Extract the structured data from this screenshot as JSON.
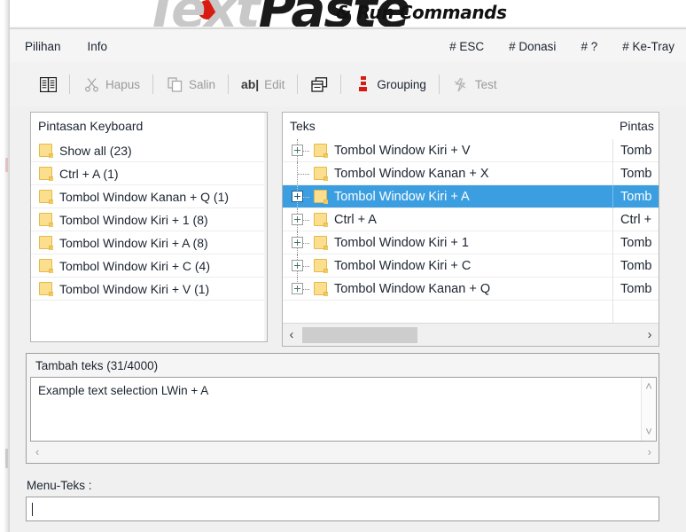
{
  "app": {
    "logo_part1": "Text",
    "logo_part2": "Paste",
    "logo_subtitle": "& Run Commands"
  },
  "menubar": {
    "left_items": [
      {
        "label": "Pilihan",
        "name": "menu-pilihan"
      },
      {
        "label": "Info",
        "name": "menu-info"
      }
    ],
    "right_items": [
      {
        "label": "# ESC",
        "name": "menu-esc"
      },
      {
        "label": "# Donasi",
        "name": "menu-donasi"
      },
      {
        "label": "# ?",
        "name": "menu-help"
      },
      {
        "label": "# Ke-Tray",
        "name": "menu-ke-tray"
      }
    ]
  },
  "toolbar": {
    "items": [
      {
        "label": "",
        "icon": "list-book-icon",
        "enabled": true,
        "name": "toolbar-list-button"
      },
      {
        "label": "Hapus",
        "icon": "scissors-icon",
        "enabled": false,
        "name": "toolbar-hapus-button"
      },
      {
        "label": "Salin",
        "icon": "copy-icon",
        "enabled": false,
        "name": "toolbar-salin-button"
      },
      {
        "label": "Edit",
        "icon": "ab-text-icon",
        "enabled": false,
        "name": "toolbar-edit-button"
      },
      {
        "label": "",
        "icon": "windows-cascade-icon",
        "enabled": true,
        "name": "toolbar-window-button"
      },
      {
        "label": "Grouping",
        "icon": "grouping-icon",
        "enabled": true,
        "name": "toolbar-grouping-button"
      },
      {
        "label": "Test",
        "icon": "lightning-test-icon",
        "enabled": false,
        "name": "toolbar-test-button"
      }
    ],
    "accent_color": "#d81b12"
  },
  "left_panel": {
    "header": "Pintasan Keyboard",
    "rows": [
      {
        "label": "Show all (23)"
      },
      {
        "label": "Ctrl + A (1)"
      },
      {
        "label": "Tombol Window Kanan + Q (1)"
      },
      {
        "label": "Tombol Window Kiri + 1 (8)"
      },
      {
        "label": "Tombol Window Kiri + A (8)"
      },
      {
        "label": "Tombol Window Kiri + C (4)"
      },
      {
        "label": "Tombol Window Kiri + V (1)"
      }
    ]
  },
  "right_panel": {
    "header_col1": "Teks",
    "header_col2": "Pintas",
    "rows": [
      {
        "label": "Tombol Window Kiri + V",
        "col2": "Tomb",
        "expandable": true,
        "selected": false
      },
      {
        "label": "Tombol Window Kanan + X",
        "col2": "Tomb",
        "expandable": false,
        "selected": false
      },
      {
        "label": "Tombol Window Kiri + A",
        "col2": "Tomb",
        "expandable": true,
        "selected": true
      },
      {
        "label": "Ctrl + A",
        "col2": "Ctrl +",
        "expandable": true,
        "selected": false
      },
      {
        "label": "Tombol Window Kiri + 1",
        "col2": "Tomb",
        "expandable": true,
        "selected": false
      },
      {
        "label": "Tombol Window Kiri + C",
        "col2": "Tomb",
        "expandable": true,
        "selected": false
      },
      {
        "label": "Tombol Window Kanan + Q",
        "col2": "Tomb",
        "expandable": true,
        "selected": false
      }
    ],
    "selection_color": "#3b9ee0",
    "hscroll": {
      "left_arrow": "‹",
      "right_arrow": "›"
    }
  },
  "text_group": {
    "title": "Tambah teks (31/4000)",
    "value": "Example text selection LWin + A",
    "scroll_up": "˄",
    "scroll_down": "˅",
    "scroll_left": "‹",
    "scroll_right": "›"
  },
  "menu_teks": {
    "label": "Menu-Teks :",
    "value": "",
    "placeholder": ""
  }
}
